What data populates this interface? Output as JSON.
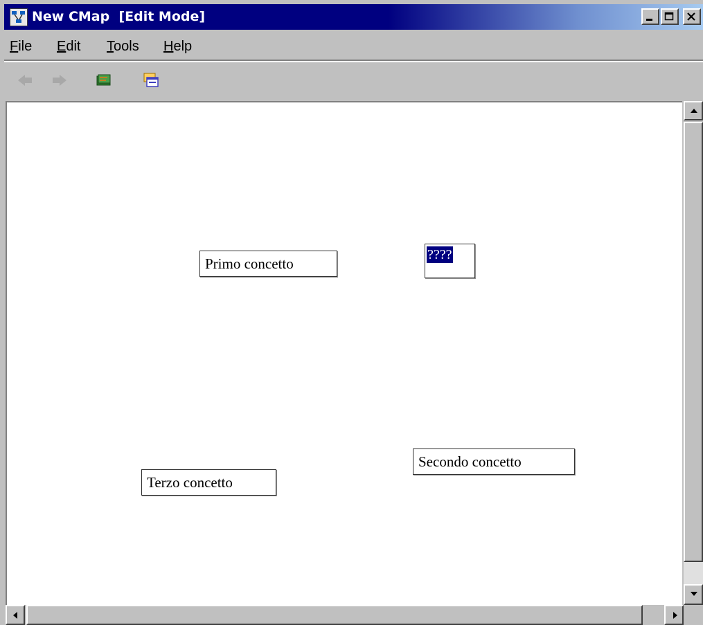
{
  "window": {
    "title": "New CMap  [Edit Mode]",
    "icons": {
      "app": "cmap-app-icon",
      "minimize": "minimize-icon",
      "maximize": "maximize-icon",
      "close": "close-icon"
    }
  },
  "menu": {
    "items": [
      {
        "label": "File",
        "accel": "F",
        "rest": "ile"
      },
      {
        "label": "Edit",
        "accel": "E",
        "rest": "dit"
      },
      {
        "label": "Tools",
        "accel": "T",
        "rest": "ools"
      },
      {
        "label": "Help",
        "accel": "H",
        "rest": "elp"
      }
    ]
  },
  "toolbar": {
    "buttons": [
      {
        "icon": "back-arrow-icon",
        "enabled": false
      },
      {
        "icon": "forward-arrow-icon",
        "enabled": false
      },
      {
        "icon": "book-icon",
        "enabled": true
      },
      {
        "icon": "window-icon",
        "enabled": true
      }
    ]
  },
  "canvas": {
    "concepts": [
      {
        "label": "Primo concetto"
      },
      {
        "label": "Secondo concetto"
      },
      {
        "label": "Terzo concetto"
      }
    ],
    "link_label": {
      "text": "????",
      "selected": true
    }
  },
  "colors": {
    "titlebar": "#000080",
    "selection": "#000080",
    "chrome": "#c0c0c0",
    "canvas": "#ffffff"
  }
}
